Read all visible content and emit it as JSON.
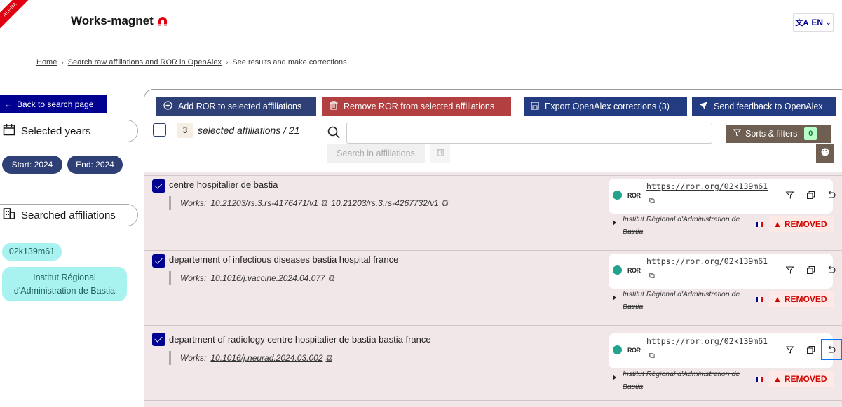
{
  "header": {
    "ribbon": "ALPHA",
    "brand": "Works-magnet",
    "lang": "EN"
  },
  "breadcrumb": {
    "home": "Home",
    "search": "Search raw affiliations and ROR in OpenAlex",
    "current": "See results and make corrections"
  },
  "sidebar": {
    "back_label": "Back to search page",
    "years_label": "Selected years",
    "start": "Start: 2024",
    "end": "End: 2024",
    "affiliations_label": "Searched affiliations",
    "chips": [
      "02k139m61",
      "Institut Régional d'Administration de Bastia"
    ]
  },
  "toolbar": {
    "add_ror": "Add ROR to selected affiliations",
    "remove_ror": "Remove ROR from selected affiliations",
    "export": "Export OpenAlex corrections (3)",
    "feedback": "Send feedback to OpenAlex",
    "selected_count": "3",
    "selected_text": "selected affiliations / 21",
    "search_value": "",
    "search_in": "Search in affiliations",
    "sorts": "Sorts & filters",
    "sorts_count": "0"
  },
  "rows": [
    {
      "name": "centre hospitalier de bastia",
      "works_label": "Works:",
      "works": [
        "10.21203/rs.3.rs-4176471/v1",
        "10.21203/rs.3.rs-4267732/v1"
      ],
      "ror_url": "https://ror.org/02k139m61",
      "ror_name": "Institut Régional d'Administration de Bastia",
      "status": "REMOVED"
    },
    {
      "name": "departement of infectious diseases bastia hospital france",
      "works_label": "Works:",
      "works": [
        "10.1016/j.vaccine.2024.04.077"
      ],
      "ror_url": "https://ror.org/02k139m61",
      "ror_name": "Institut Régional d'Administration de Bastia",
      "status": "REMOVED"
    },
    {
      "name": "department of radiology centre hospitalier de bastia bastia france",
      "works_label": "Works:",
      "works": [
        "10.1016/j.neurad.2024.03.002"
      ],
      "ror_url": "https://ror.org/02k139m61",
      "ror_name": "Institut Régional d'Administration de Bastia",
      "status": "REMOVED"
    }
  ],
  "ror_logo": "ROR",
  "colors": {
    "primary": "#000091",
    "danger": "#b34040",
    "removed": "#ce0500",
    "panel_bg": "#f1e6e8",
    "chip": "#a8f2ef",
    "ror_dot": "#21a38c"
  }
}
